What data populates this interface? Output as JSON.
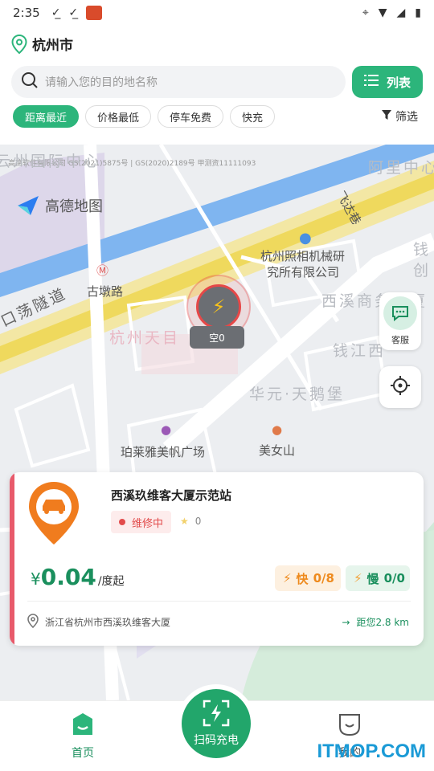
{
  "status_bar": {
    "time": "2:35"
  },
  "header": {
    "city": "杭州市"
  },
  "search": {
    "placeholder": "请输入您的目的地名称"
  },
  "list_button": {
    "label": "列表"
  },
  "filters": {
    "chips": [
      "距离最近",
      "价格最低",
      "停车免费",
      "快充"
    ],
    "active_index": 0,
    "filter_label": "筛选"
  },
  "map": {
    "copyright": "高德软件有限公司 GS(2021)5875号 | GS(2020)2189号 甲测资11111093",
    "logo_text": "高德地图",
    "labels": {
      "top_left": "云州国际中心",
      "top_right": "阿里中心",
      "feida": "飞达巷",
      "zhaoxiang": "杭州照相机械研",
      "zhaoxiang2": "究所有限公司",
      "gudun": "古墩路",
      "tunnel": "口荡隧道",
      "xixi": "西溪商务大厦",
      "tianmu": "杭州天目",
      "qianjiang": "钱江西",
      "huayuan": "华元·天鹅堡",
      "plaza": "珀莱雅美帆广场",
      "meinv": "美女山",
      "qian": "钱",
      "chuang": "创"
    },
    "marker_tag": "空0"
  },
  "customer_service": {
    "label": "客服"
  },
  "station": {
    "name": "西溪玖维客大厦示范站",
    "status": "维修中",
    "rating": "0",
    "price_currency": "¥",
    "price": "0.04",
    "price_unit": "/度起",
    "fast_label": "快",
    "fast_count": "0/8",
    "slow_label": "慢",
    "slow_count": "0/0",
    "address": "浙江省杭州市西溪玖维客大厦",
    "distance": "距您2.8 km"
  },
  "tabbar": {
    "home": "首页",
    "scan": "扫码充电",
    "mine": "我的"
  },
  "watermark": "ITMOP.COM",
  "colors": {
    "brand": "#2cb57b",
    "alert": "#e24b4b",
    "fast": "#ee8a1d"
  }
}
